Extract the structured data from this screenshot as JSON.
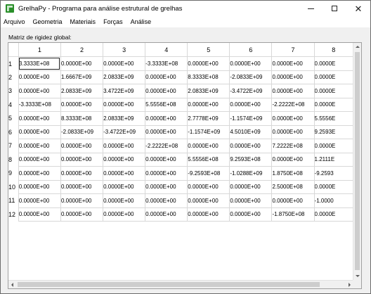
{
  "window": {
    "title": "GrelhaPy - Programa para análise estrutural de grelhas",
    "icon": "app-grid-icon",
    "controls": {
      "minimize": "minimize-icon",
      "maximize": "maximize-icon",
      "close_symbol": "✕"
    }
  },
  "menu": [
    "Arquivo",
    "Geometria",
    "Materiais",
    "Forças",
    "Análise"
  ],
  "matrix": {
    "label": "Matriz de rigidez global:",
    "column_headers": [
      "1",
      "2",
      "3",
      "4",
      "5",
      "6",
      "7",
      "8"
    ],
    "row_headers": [
      "1",
      "2",
      "3",
      "4",
      "5",
      "6",
      "7",
      "8",
      "9",
      "10",
      "11",
      "12"
    ],
    "selected_cell": [
      0,
      0
    ],
    "rows": [
      [
        "3.3333E+08",
        "0.0000E+00",
        "0.0000E+00",
        "-3.3333E+08",
        "0.0000E+00",
        "0.0000E+00",
        "0.0000E+00",
        "0.0000E"
      ],
      [
        "0.0000E+00",
        "1.6667E+09",
        "2.0833E+09",
        "0.0000E+00",
        "8.3333E+08",
        "-2.0833E+09",
        "0.0000E+00",
        "0.0000E"
      ],
      [
        "0.0000E+00",
        "2.0833E+09",
        "3.4722E+09",
        "0.0000E+00",
        "2.0833E+09",
        "-3.4722E+09",
        "0.0000E+00",
        "0.0000E"
      ],
      [
        "-3.3333E+08",
        "0.0000E+00",
        "0.0000E+00",
        "5.5556E+08",
        "0.0000E+00",
        "0.0000E+00",
        "-2.2222E+08",
        "0.0000E"
      ],
      [
        "0.0000E+00",
        "8.3333E+08",
        "2.0833E+09",
        "0.0000E+00",
        "2.7778E+09",
        "-1.1574E+09",
        "0.0000E+00",
        "5.5556E"
      ],
      [
        "0.0000E+00",
        "-2.0833E+09",
        "-3.4722E+09",
        "0.0000E+00",
        "-1.1574E+09",
        "4.5010E+09",
        "0.0000E+00",
        "9.2593E"
      ],
      [
        "0.0000E+00",
        "0.0000E+00",
        "0.0000E+00",
        "-2.2222E+08",
        "0.0000E+00",
        "0.0000E+00",
        "7.2222E+08",
        "0.0000E"
      ],
      [
        "0.0000E+00",
        "0.0000E+00",
        "0.0000E+00",
        "0.0000E+00",
        "5.5556E+08",
        "9.2593E+08",
        "0.0000E+00",
        "1.2111E"
      ],
      [
        "0.0000E+00",
        "0.0000E+00",
        "0.0000E+00",
        "0.0000E+00",
        "-9.2593E+08",
        "-1.0288E+09",
        "1.8750E+08",
        "-9.2593"
      ],
      [
        "0.0000E+00",
        "0.0000E+00",
        "0.0000E+00",
        "0.0000E+00",
        "0.0000E+00",
        "0.0000E+00",
        "2.5000E+08",
        "0.0000E"
      ],
      [
        "0.0000E+00",
        "0.0000E+00",
        "0.0000E+00",
        "0.0000E+00",
        "0.0000E+00",
        "0.0000E+00",
        "0.0000E+00",
        "-1.0000"
      ],
      [
        "0.0000E+00",
        "0.0000E+00",
        "0.0000E+00",
        "0.0000E+00",
        "0.0000E+00",
        "0.0000E+00",
        "-1.8750E+08",
        "0.0000E"
      ]
    ]
  },
  "colors": {
    "app_icon": "#2a8f2a",
    "grid_line": "#d8d8d8",
    "window_bg": "#f0f0f0"
  }
}
